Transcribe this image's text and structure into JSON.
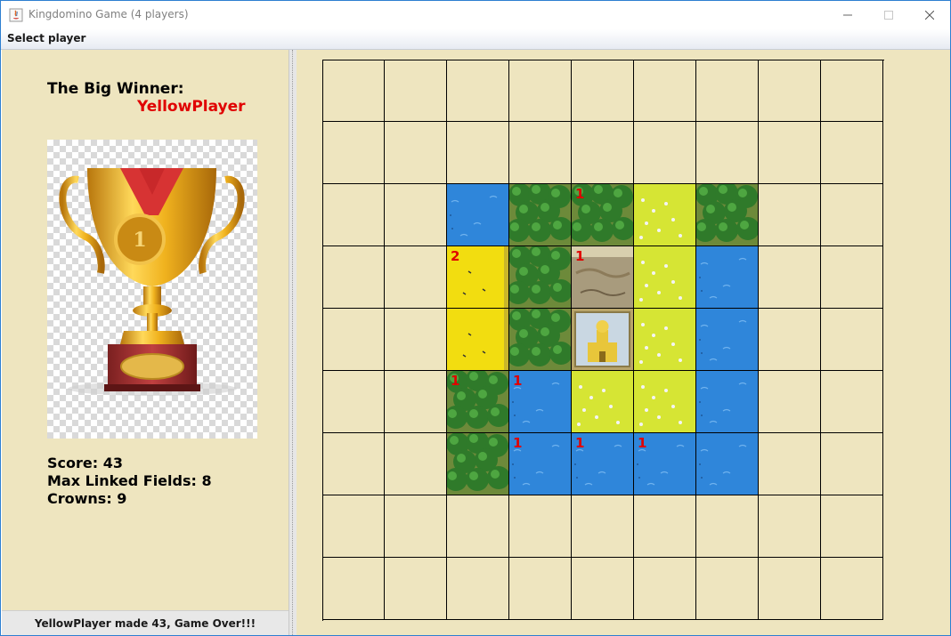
{
  "window": {
    "title": "Kingdomino Game (4 players)"
  },
  "menu": {
    "items": [
      "Select player"
    ]
  },
  "winner": {
    "heading": "The Big Winner:",
    "name": "YellowPlayer"
  },
  "stats": {
    "score": "Score: 43",
    "max_linked": "Max Linked Fields: 8",
    "crowns": "Crowns: 9"
  },
  "status": {
    "message": "YellowPlayer made 43, Game Over!!!"
  },
  "colors": {
    "accent_red": "#e00000",
    "panel_bg": "#eee5bf",
    "water": "#2f86da",
    "forest": "#2f7a2a",
    "meadow": "#cfe028",
    "wheat": "#f2dd10",
    "swamp": "#a89b7d"
  },
  "board": {
    "rows": 9,
    "cols": 9,
    "tiles": [
      [
        null,
        null,
        null,
        null,
        null,
        null,
        null,
        null,
        null
      ],
      [
        null,
        null,
        null,
        null,
        null,
        null,
        null,
        null,
        null
      ],
      [
        null,
        null,
        {
          "type": "water",
          "crowns": 0
        },
        {
          "type": "forest",
          "crowns": 0
        },
        {
          "type": "forest",
          "crowns": 1
        },
        {
          "type": "meadow",
          "crowns": 0
        },
        {
          "type": "forest",
          "crowns": 0
        },
        null,
        null
      ],
      [
        null,
        null,
        {
          "type": "wheat",
          "crowns": 2
        },
        {
          "type": "forest",
          "crowns": 0
        },
        {
          "type": "swamp",
          "crowns": 1
        },
        {
          "type": "meadow",
          "crowns": 0
        },
        {
          "type": "water",
          "crowns": 0
        },
        null,
        null
      ],
      [
        null,
        null,
        {
          "type": "wheat",
          "crowns": 0
        },
        {
          "type": "forest",
          "crowns": 0
        },
        {
          "type": "castle",
          "crowns": 0
        },
        {
          "type": "meadow",
          "crowns": 0
        },
        {
          "type": "water",
          "crowns": 0
        },
        null,
        null
      ],
      [
        null,
        null,
        {
          "type": "forest",
          "crowns": 1
        },
        {
          "type": "water",
          "crowns": 1
        },
        {
          "type": "meadow",
          "crowns": 0
        },
        {
          "type": "meadow",
          "crowns": 0
        },
        {
          "type": "water",
          "crowns": 0
        },
        null,
        null
      ],
      [
        null,
        null,
        {
          "type": "forest",
          "crowns": 0
        },
        {
          "type": "water",
          "crowns": 1
        },
        {
          "type": "water",
          "crowns": 1
        },
        {
          "type": "water",
          "crowns": 1
        },
        {
          "type": "water",
          "crowns": 0
        },
        null,
        null
      ],
      [
        null,
        null,
        null,
        null,
        null,
        null,
        null,
        null,
        null
      ],
      [
        null,
        null,
        null,
        null,
        null,
        null,
        null,
        null,
        null
      ]
    ]
  }
}
